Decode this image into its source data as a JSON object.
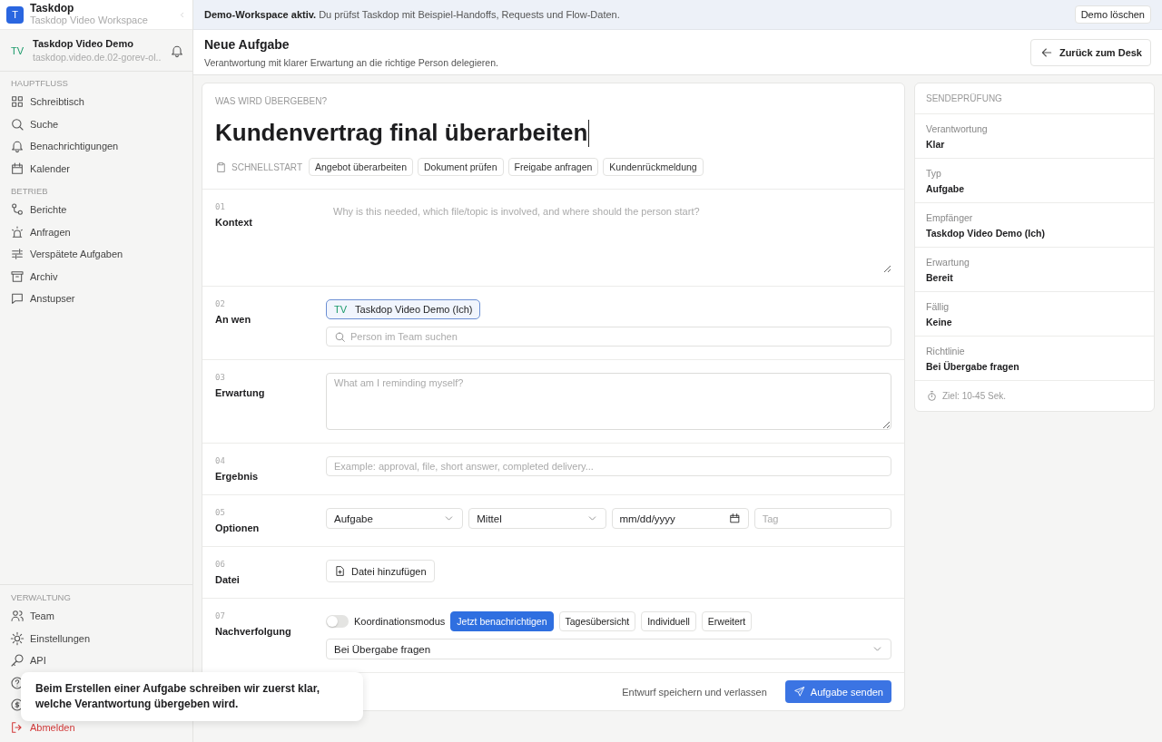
{
  "sidebar": {
    "brand": {
      "logo": "T",
      "name": "Taskdop",
      "workspace": "Taskdop Video Workspace"
    },
    "account": {
      "initials": "TV",
      "name": "Taskdop Video Demo",
      "email": "taskdop.video.de.02-gorev-ol.."
    },
    "sections": [
      {
        "title": "HAUPTFLUSS",
        "items": [
          {
            "label": "Schreibtisch",
            "selected": false
          },
          {
            "label": "Suche",
            "selected": false
          },
          {
            "label": "Benachrichtigungen",
            "selected": false
          },
          {
            "label": "Kalender",
            "selected": false
          }
        ]
      },
      {
        "title": "BETRIEB",
        "items": [
          {
            "label": "Berichte",
            "selected": false
          },
          {
            "label": "Anfragen",
            "selected": false
          },
          {
            "label": "Verspätete Aufgaben",
            "selected": false
          },
          {
            "label": "Archiv",
            "selected": false
          },
          {
            "label": "Anstupser",
            "selected": false
          }
        ]
      },
      {
        "title": "VERWALTUNG",
        "items": [
          {
            "label": "Team",
            "selected": false
          },
          {
            "label": "Einstellungen",
            "selected": false
          },
          {
            "label": "API",
            "selected": false
          }
        ]
      }
    ],
    "logout": {
      "label": "Abmelden"
    }
  },
  "tooltip": {
    "text": "Beim Erstellen einer Aufgabe schreiben wir zuerst klar, welche Verantwortung übergeben wird."
  },
  "banner": {
    "text": "**Demo-Workspace aktiv.** Du prüfst Taskdop mit Beispiel-Handoffs, Requests und Flow-Daten.",
    "button": "Demo löschen"
  },
  "header": {
    "title": "Neue Aufgabe",
    "subtitle": "Verantwortung mit klarer Erwartung an die richtige Person delegieren.",
    "back_button": "Zurück zum Desk"
  },
  "form": {
    "eyebrow": "WAS WIRD ÜBERGEBEN?",
    "title": "Kundenvertrag final überarbeiten",
    "quickstart": {
      "label": "SCHNELLSTART",
      "chips": [
        "Angebot überarbeiten",
        "Dokument prüfen",
        "Freigabe anfragen",
        "Kundenrückmeldung"
      ]
    },
    "rows": [
      {
        "number": "01",
        "label": "Kontext",
        "kind": "textarea",
        "placeholder": "Why is this needed, which file/topic is involved, and where should the person start?"
      },
      {
        "number": "02",
        "label": "An wen",
        "kind": "recipient",
        "chip": {
          "initials": "TV",
          "name": "Taskdop Video Demo (Ich)"
        },
        "placeholder": "Person im Team suchen"
      },
      {
        "number": "03",
        "label": "Erwartung",
        "kind": "textarea",
        "placeholder": "What am I reminding myself?"
      },
      {
        "number": "04",
        "label": "Ergebnis",
        "kind": "input",
        "placeholder": "Example: approval, file, short answer, completed delivery..."
      },
      {
        "number": "05",
        "label": "Optionen",
        "kind": "options",
        "fields": [
          {
            "kind": "select",
            "value": "Aufgabe"
          },
          {
            "kind": "select",
            "value": "Mittel"
          },
          {
            "kind": "date",
            "value": "mm/dd/yyyy"
          },
          {
            "kind": "text",
            "placeholder": "Tag"
          }
        ]
      },
      {
        "number": "06",
        "label": "Datei",
        "kind": "file",
        "button": "Datei hinzufügen"
      },
      {
        "number": "07",
        "label": "Nachverfolgung",
        "kind": "followup",
        "toggle": {
          "label": "Koordinationsmodus",
          "on": false
        },
        "modes": [
          {
            "label": "Jetzt benachrichtigen",
            "selected": true
          },
          {
            "label": "Tagesübersicht",
            "selected": false
          },
          {
            "label": "Individuell",
            "selected": false
          },
          {
            "label": "Erweitert",
            "selected": false
          }
        ],
        "select": "Bei Übergabe fragen"
      }
    ],
    "footer": {
      "draft": "Entwurf speichern und verlassen",
      "submit": "Aufgabe senden"
    }
  },
  "check": {
    "title": "SENDEPRÜFUNG",
    "items": [
      {
        "label": "Verantwortung",
        "value": "Klar"
      },
      {
        "label": "Typ",
        "value": "Aufgabe"
      },
      {
        "label": "Empfänger",
        "value": "Taskdop Video Demo (Ich)"
      },
      {
        "label": "Erwartung",
        "value": "Bereit"
      },
      {
        "label": "Fällig",
        "value": "Keine"
      },
      {
        "label": "Richtlinie",
        "value": "Bei Übergabe fragen"
      }
    ],
    "note": "Ziel: 10-45 Sek."
  }
}
